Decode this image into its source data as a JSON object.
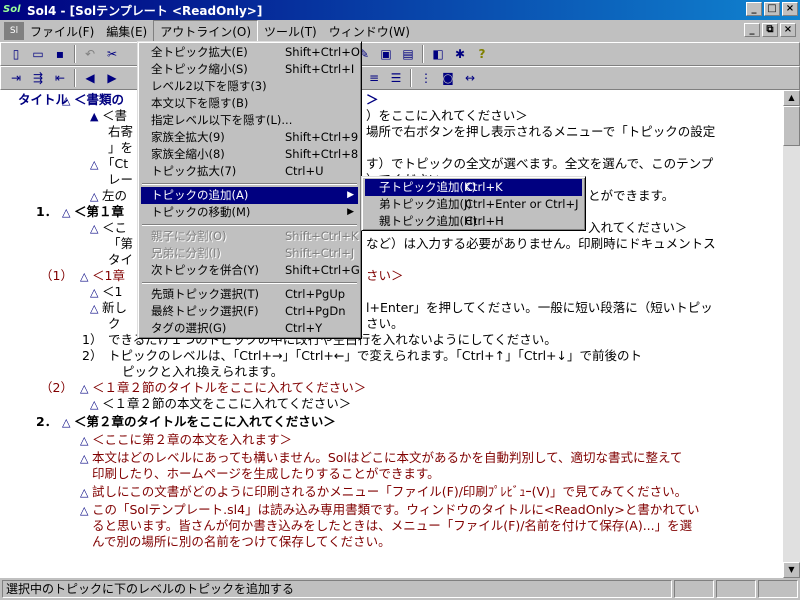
{
  "window": {
    "title": "Sol4 - [Solテンプレート <ReadOnly>]",
    "app_icon": "sol-icon",
    "buttons": [
      "_",
      "□",
      "×"
    ]
  },
  "menubar": {
    "items": [
      "ファイル(F)",
      "編集(E)",
      "アウトライン(O)",
      "ツール(T)",
      "ウィンドウ(W)"
    ],
    "active": "アウトライン(O)",
    "mdi_buttons": [
      "_",
      "⧉",
      "×"
    ]
  },
  "action_menu": {
    "items": [
      {
        "label": "全トピック拡大(E)",
        "key": "Shift+Ctrl+O",
        "disabled": false
      },
      {
        "label": "全トピック縮小(S)",
        "key": "Shift+Ctrl+I",
        "disabled": false
      },
      {
        "label": "レベル2以下を隠す(3)",
        "key": "",
        "disabled": false
      },
      {
        "label": "本文以下を隠す(B)",
        "key": "",
        "disabled": false
      },
      {
        "label": "指定レベル以下を隠す(L)...",
        "key": "",
        "disabled": false
      },
      {
        "label": "家族全拡大(9)",
        "key": "Shift+Ctrl+9",
        "disabled": false
      },
      {
        "label": "家族全縮小(8)",
        "key": "Shift+Ctrl+8",
        "disabled": false
      },
      {
        "label": "トピック拡大(7)",
        "key": "Ctrl+U",
        "disabled": false
      },
      {
        "label": "トピックの追加(A)",
        "key": "",
        "disabled": false,
        "submenu": true
      },
      {
        "label": "トピックの移動(M)",
        "key": "",
        "disabled": false,
        "submenu": true
      },
      {
        "label": "親子に分割(O)",
        "key": "Shift+Ctrl+K",
        "disabled": true
      },
      {
        "label": "兄弟に分割(I)",
        "key": "Shift+Ctrl+J",
        "disabled": true
      },
      {
        "label": "次トピックを併合(Y)",
        "key": "Shift+Ctrl+G",
        "disabled": false
      },
      {
        "label": "先頭トピック選択(T)",
        "key": "Ctrl+PgUp",
        "disabled": false
      },
      {
        "label": "最終トピック選択(F)",
        "key": "Ctrl+PgDn",
        "disabled": false
      },
      {
        "label": "タグの選択(G)",
        "key": "Ctrl+Y",
        "disabled": false
      }
    ],
    "highlighted": "トピックの追加(A)"
  },
  "add_submenu": {
    "items": [
      {
        "label": "子トピック追加(K)",
        "key": "Ctrl+K"
      },
      {
        "label": "弟トピック追加(J)",
        "key": "Ctrl+Enter or Ctrl+J"
      },
      {
        "label": "親トピック追加(H)",
        "key": "Ctrl+H"
      }
    ],
    "highlighted": "子トピック追加(K)"
  },
  "editor": {
    "lines": [
      {
        "label": "タイトル",
        "tri": "△",
        "text": "＜書類の"
      },
      {
        "label": "",
        "tri": "▲",
        "text": "＜書"
      },
      {
        "label": "",
        "tri": "",
        "text": "右寄"
      },
      {
        "label": "",
        "tri": "",
        "text": "」を"
      },
      {
        "label": "",
        "tri": "△",
        "text": "「Ct"
      },
      {
        "label": "",
        "tri": "",
        "text": "レー"
      },
      {
        "label": "",
        "tri": "△",
        "text": "左の"
      },
      {
        "label": "1．",
        "tri": "△",
        "text": "＜第１章"
      },
      {
        "label": "",
        "tri": "△",
        "text": "＜こ"
      },
      {
        "label": "",
        "tri": "",
        "text": "「第"
      },
      {
        "label": "",
        "tri": "",
        "text": "タイ"
      },
      {
        "label": "（1）",
        "tri": "△",
        "text": "＜1章"
      },
      {
        "label": "",
        "tri": "△",
        "text": "＜1"
      },
      {
        "label": "",
        "tri": "△",
        "text": "新し"
      },
      {
        "label": "",
        "tri": "",
        "text": "ク"
      },
      {
        "label": "1）",
        "tri": "△",
        "text": "できるだけ１つのトピックの中に改行や空白行を入れないようにしてください。"
      },
      {
        "label": "2）",
        "tri": "△",
        "text": "トピックのレベルは、「Ctrl+→」「Ctrl+←」で変えられます。「Ctrl+↑」「Ctrl+↓」で前後のト"
      },
      {
        "label": "",
        "tri": "",
        "text": "ピックと入れ換えられます。"
      },
      {
        "label": "（2）",
        "tri": "△",
        "text": "＜１章２節のタイトルをここに入れてください＞"
      },
      {
        "label": "",
        "tri": "△",
        "text": "＜１章２節の本文をここに入れてください＞"
      },
      {
        "label": "2．",
        "tri": "△",
        "text": "＜第２章のタイトルをここに入れてください＞"
      },
      {
        "label": "",
        "tri": "△",
        "text": "＜ここに第２章の本文を入れます＞"
      },
      {
        "label": "",
        "tri": "△",
        "text": "本文はどのレベルにあっても構いません。Solはどこに本文があるかを自動判別して、適切な書式に整えて"
      },
      {
        "label": "",
        "tri": "",
        "text": "印刷したり、ホームページを生成したりすることができます。"
      },
      {
        "label": "",
        "tri": "△",
        "text": "試しにこの文書がどのように印刷されるかメニュー「ファイル(F)/印刷ﾌﾟﾚﾋﾞｭｰ(V)」で見てみてください。"
      },
      {
        "label": "",
        "tri": "△",
        "text": "この「Solテンプレート.sl4」は読み込み専用書類です。ウィンドウのタイトルに<ReadOnly>と書かれてい"
      },
      {
        "label": "",
        "tri": "",
        "text": "ると思います。皆さんが何か書き込みをしたときは、メニュー「ファイル(F)/名前を付けて保存(A)...」を選"
      },
      {
        "label": "",
        "tri": "",
        "text": "んで別の場所に別の名前をつけて保存してください。"
      }
    ],
    "right_fragments": [
      {
        "text": "＞"
      },
      {
        "text": "）をここに入れてください＞"
      },
      {
        "text": "場所で右ボタンを押し表示されるメニューで「トピックの設定"
      },
      {
        "text": "す）でトピックの全文が選べます。全文を選んで、このテンプ"
      },
      {
        "text": "）でください。"
      },
      {
        "text": "とができます。"
      },
      {
        "text": "入れてください＞"
      },
      {
        "text": "など）は入力する必要がありません。印刷時にドキュメントス"
      },
      {
        "text": "さい＞"
      },
      {
        "text": "l+Enter」を押してください。一般に短い段落に（短いトピッ"
      },
      {
        "text": "さい。"
      }
    ]
  },
  "statusbar": {
    "message": "選択中のトピックに下のレベルのトピックを追加する"
  },
  "colors": {
    "titlebar": "#000080",
    "menu_highlight": "#000080",
    "topic_blue": "#000080",
    "body_red": "#800000"
  }
}
